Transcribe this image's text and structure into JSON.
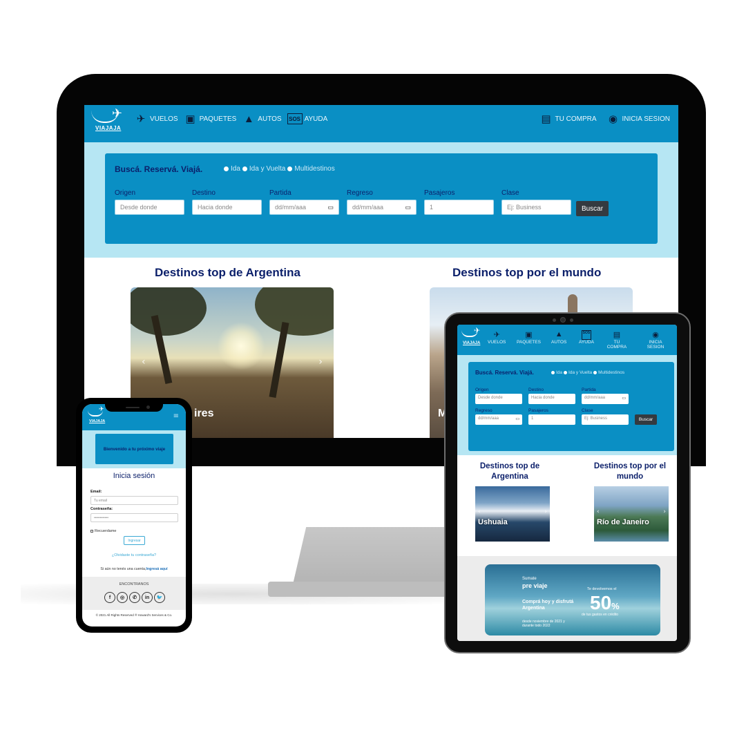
{
  "brand": {
    "name": "VIAJAJA",
    "primary": "#0a8fc4",
    "hero_bg": "#b6e6f3",
    "title_color": "#0b1f6a",
    "button_dark": "#343a40"
  },
  "desktop": {
    "nav": {
      "items": [
        {
          "label": "VUELOS",
          "icon": "plane-icon"
        },
        {
          "label": "PAQUETES",
          "icon": "suitcase-icon"
        },
        {
          "label": "AUTOS",
          "icon": "car-icon"
        },
        {
          "label": "AYUDA",
          "icon": "sos-icon"
        }
      ],
      "right": [
        {
          "label": "TU COMPRA",
          "icon": "ticket-icon"
        },
        {
          "label": "INICIA SESION",
          "icon": "passport-icon"
        }
      ]
    },
    "search": {
      "title": "Buscá. Reservá. Viajá.",
      "trip_types": [
        "Ida",
        "Ida y Vuelta",
        "Multidestinos"
      ],
      "fields": [
        {
          "label": "Origen",
          "placeholder": "Desde donde"
        },
        {
          "label": "Destino",
          "placeholder": "Hacia donde"
        },
        {
          "label": "Partida",
          "placeholder": "dd/mm/aaa"
        },
        {
          "label": "Regreso",
          "placeholder": "dd/mm/aaa"
        },
        {
          "label": "Pasajeros",
          "placeholder": "1"
        },
        {
          "label": "Clase",
          "placeholder": "Ej: Business"
        }
      ],
      "button": "Buscar"
    },
    "sections": {
      "argentina_title": "Destinos top de Argentina",
      "world_title": "Destinos top por el mundo",
      "argentina_caption": "ires",
      "world_caption": "M"
    }
  },
  "tablet": {
    "nav": {
      "brand": "VIAJAJA",
      "items": [
        "VUELOS",
        "PAQUETES",
        "AUTOS",
        "AYUDA",
        "TU COMPRA",
        "INICIA SESION"
      ]
    },
    "search": {
      "title": "Buscá. Reservá. Viajá.",
      "trip_types": [
        "Ida",
        "Ida y Vuelta",
        "Multidestinos"
      ],
      "fields": [
        {
          "label": "Origen",
          "placeholder": "Desde donde"
        },
        {
          "label": "Destino",
          "placeholder": "Hacia donde"
        },
        {
          "label": "Partida",
          "placeholder": "dd/mm/aaa"
        },
        {
          "label": "Regreso",
          "placeholder": "dd/mm/aaa"
        },
        {
          "label": "Pasajeros",
          "placeholder": "1"
        },
        {
          "label": "Clase",
          "placeholder": "Ej: Business"
        }
      ],
      "button": "Buscar"
    },
    "sections": {
      "argentina_title": "Destinos top de Argentina",
      "world_title": "Destinos top por el mundo",
      "argentina_caption": "Ushuaia",
      "world_caption": "Río de Janeiro"
    },
    "banner": {
      "small_top": "Sumate",
      "brand": "pre viaje",
      "headline": "Comprá hoy y disfrutá Argentina",
      "dates": "desde noviembre de 2021 y durante todo 2022",
      "refund_label": "Te devolvemos el",
      "percent": "50",
      "percent_sign": "%",
      "refund_sub": "de tus gastos en crédito"
    }
  },
  "phone": {
    "brand": "VIAJAJA",
    "welcome": "Bienvenido a tu próximo viaje",
    "login_title": "Inicia sesión",
    "email_label": "Email:",
    "email_placeholder": "Tu email",
    "password_label": "Contraseña:",
    "password_placeholder": "••••••••••••",
    "remember": "Recuerdame",
    "login_button": "Ingresar",
    "forgot": "¿Olvidaste tu contraseña?",
    "register_text": "Si aún no tenés una cuenta,",
    "register_link": "Ingresá aquí",
    "find_us": "ENCONTRANOS",
    "social": [
      "f",
      "◎",
      "✆",
      "in",
      "🐦"
    ],
    "copyright": "© 2021 All Rights Reserved ® Howard's Services & Co."
  }
}
